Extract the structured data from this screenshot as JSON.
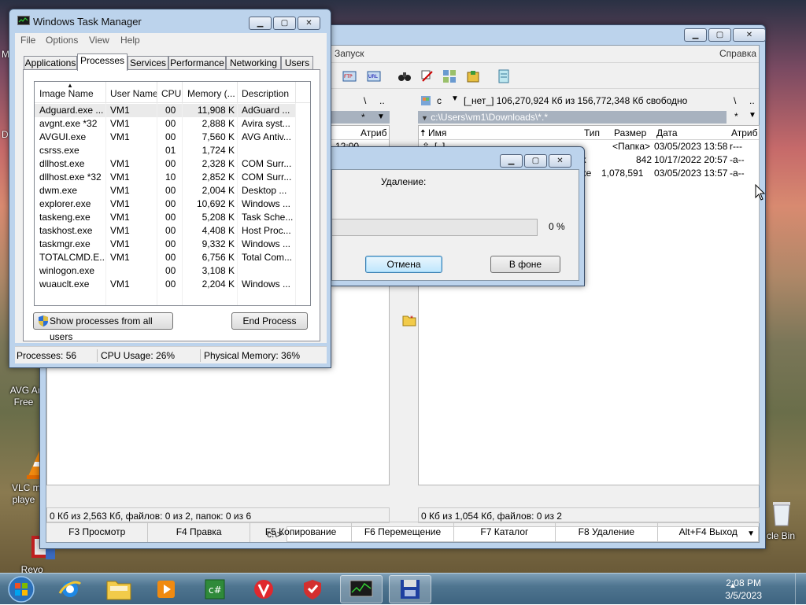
{
  "desktop": {
    "icons": [
      {
        "label": "AVG Anti\nFree"
      },
      {
        "label": "VLC me\nplaye"
      },
      {
        "label": "Revo\nUninstaller"
      },
      {
        "label": "cle Bin"
      }
    ],
    "edge_letters": [
      "M",
      "D"
    ]
  },
  "total_commander": {
    "menu": {
      "start": "Запуск",
      "help": "Справка"
    },
    "left": {
      "up": "\\",
      "dotdot": "..",
      "star": "*",
      "col_attr": "Атриб",
      "time": "12:00",
      "status": "0 Кб из 2,563 Кб, файлов: 0 из 2, папок: 0 из 6"
    },
    "right": {
      "drive": "c",
      "drive_info": "[_нет_]  106,270,924 Кб из 156,772,348 Кб свободно",
      "up": "\\",
      "dotdot": "..",
      "star": "*",
      "path": "c:\\Users\\vm1\\Downloads\\*.*",
      "headers": {
        "name": "Имя",
        "type": "Тип",
        "size": "Размер",
        "date": "Дата",
        "attr": "Атриб"
      },
      "files": [
        {
          "name": "[..]",
          "type": "",
          "size": "<Папка>",
          "date": "03/05/2023 13:58",
          "attr": "r---"
        },
        {
          "name": "",
          "type": "nk",
          "size": "842",
          "date": "10/17/2022 20:57",
          "attr": "-a--"
        },
        {
          "name": "",
          "type": "exe",
          "size": "1,078,591",
          "date": "03/05/2023 13:57",
          "attr": "-a--"
        }
      ],
      "status": "0 Кб из 1,054 Кб, файлов: 0 из 2"
    },
    "cmd_prompt": "c:\\>",
    "fkeys": [
      "F3 Просмотр",
      "F4 Правка",
      "F5 Копирование",
      "F6 Перемещение",
      "F7 Каталог",
      "F8 Удаление",
      "Alt+F4 Выход"
    ]
  },
  "delete_dialog": {
    "label": "Удаление:",
    "progress_percent_text": "0 %",
    "progress_fraction": 0,
    "cancel": "Отмена",
    "background": "В фоне"
  },
  "task_manager": {
    "title": "Windows Task Manager",
    "menu": [
      "File",
      "Options",
      "View",
      "Help"
    ],
    "tabs": [
      "Applications",
      "Processes",
      "Services",
      "Performance",
      "Networking",
      "Users"
    ],
    "active_tab": "Processes",
    "columns": [
      "Image Name",
      "User Name",
      "CPU",
      "Memory (...",
      "Description"
    ],
    "processes": [
      {
        "image": "Adguard.exe ...",
        "user": "VM1",
        "cpu": "00",
        "mem": "11,908 K",
        "desc": "AdGuard ..."
      },
      {
        "image": "avgnt.exe *32",
        "user": "VM1",
        "cpu": "00",
        "mem": "2,888 K",
        "desc": "Avira syst..."
      },
      {
        "image": "AVGUI.exe",
        "user": "VM1",
        "cpu": "00",
        "mem": "7,560 K",
        "desc": "AVG Antiv..."
      },
      {
        "image": "csrss.exe",
        "user": "",
        "cpu": "01",
        "mem": "1,724 K",
        "desc": ""
      },
      {
        "image": "dllhost.exe",
        "user": "VM1",
        "cpu": "00",
        "mem": "2,328 K",
        "desc": "COM Surr..."
      },
      {
        "image": "dllhost.exe *32",
        "user": "VM1",
        "cpu": "10",
        "mem": "2,852 K",
        "desc": "COM Surr..."
      },
      {
        "image": "dwm.exe",
        "user": "VM1",
        "cpu": "00",
        "mem": "2,004 K",
        "desc": "Desktop ..."
      },
      {
        "image": "explorer.exe",
        "user": "VM1",
        "cpu": "00",
        "mem": "10,692 K",
        "desc": "Windows ..."
      },
      {
        "image": "taskeng.exe",
        "user": "VM1",
        "cpu": "00",
        "mem": "5,208 K",
        "desc": "Task Sche..."
      },
      {
        "image": "taskhost.exe",
        "user": "VM1",
        "cpu": "00",
        "mem": "4,408 K",
        "desc": "Host Proc..."
      },
      {
        "image": "taskmgr.exe",
        "user": "VM1",
        "cpu": "00",
        "mem": "9,332 K",
        "desc": "Windows ..."
      },
      {
        "image": "TOTALCMD.E...",
        "user": "VM1",
        "cpu": "00",
        "mem": "6,756 K",
        "desc": "Total Com..."
      },
      {
        "image": "winlogon.exe",
        "user": "",
        "cpu": "00",
        "mem": "3,108 K",
        "desc": ""
      },
      {
        "image": "wuauclt.exe",
        "user": "VM1",
        "cpu": "00",
        "mem": "2,204 K",
        "desc": "Windows ..."
      }
    ],
    "show_all_button": "Show processes from all users",
    "end_process_button": "End Process",
    "status": {
      "processes": "Processes: 56",
      "cpu": "CPU Usage: 26%",
      "memory": "Physical Memory: 36%"
    }
  },
  "taskbar": {
    "time": "2:08 PM",
    "date": "3/5/2023",
    "items": [
      "start-orb-icon",
      "ie-icon",
      "explorer-icon",
      "media-icon",
      "csharp-icon",
      "vivaldi-icon",
      "adguard-icon",
      "taskmgr-icon",
      "totalcmd-icon"
    ]
  }
}
